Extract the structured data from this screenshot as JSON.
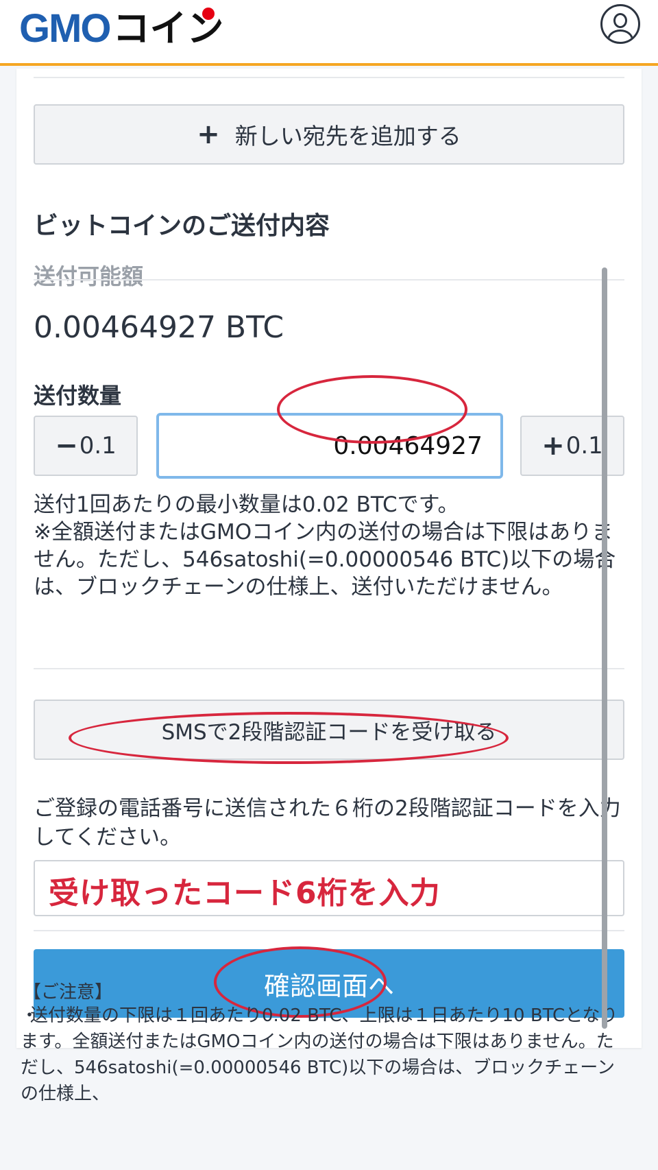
{
  "header": {
    "logo_gmo": "GMO",
    "logo_coin": "コイン"
  },
  "form": {
    "add_destination_label": "新しい宛先を追加する",
    "section_title": "ビットコインのご送付内容",
    "available_label": "送付可能額",
    "available_value": "0.00464927 BTC",
    "amount_label": "送付数量",
    "minus_label": "0.1",
    "plus_label": "0.1",
    "amount_value": "0.00464927",
    "note_line1": "送付1回あたりの最小数量は0.02 BTCです。",
    "note_line2": "※全額送付またはGMOコイン内の送付の場合は下限はありません。ただし、546satoshi(=0.00000546 BTC)以下の場合は、ブロックチェーンの仕様上、送付いただけません。",
    "sms_button_label": "SMSで2段階認証コードを受け取る",
    "sms_description": "ご登録の電話番号に送信された６桁の2段階認証コードを入力してください。",
    "code_annotation": "受け取ったコード6桁を入力",
    "confirm_button_label": "確認画面へ"
  },
  "notice": {
    "title": "【ご注意】",
    "body": "送付数量の下限は１回あたり0.02 BTC、上限は１日あたり10 BTCとなります。全額送付またはGMOコイン内の送付の場合は下限はありません。ただし、546satoshi(=0.00000546 BTC)以下の場合は、ブロックチェーンの仕様上、"
  },
  "colors": {
    "brand_blue": "#1f5fb0",
    "accent_orange": "#f5a623",
    "primary_button": "#3b9ad9",
    "annotation_red": "#d7263d"
  }
}
